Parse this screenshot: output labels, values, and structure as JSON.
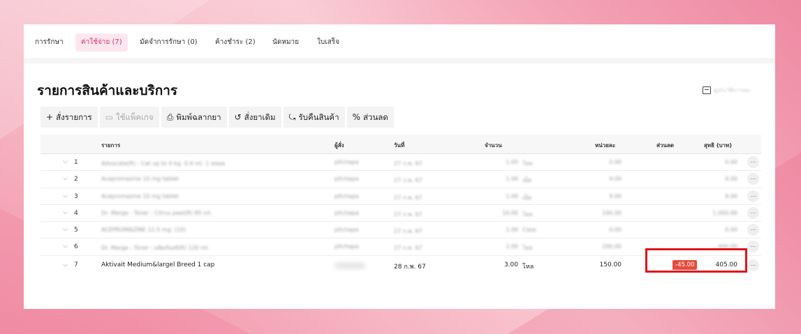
{
  "tabs": [
    {
      "label": "การรักษา",
      "active": false
    },
    {
      "label": "ค่าใช้จ่าย (7)",
      "active": true
    },
    {
      "label": "มัดจำการรักษา (0)",
      "active": false
    },
    {
      "label": "ค้างชำระ (2)",
      "active": false
    },
    {
      "label": "นัดหมาย",
      "active": false
    },
    {
      "label": "ใบเสร็จ",
      "active": false
    }
  ],
  "section": {
    "title": "รายการสินค้าและบริการ",
    "history_label": "ดูประวัติการลบ"
  },
  "toolbar": {
    "order": "สั่งรายการ",
    "package": "ใช้แพ็คเกจ",
    "print_label": "พิมพ์ฉลากยา",
    "reorder": "สั่งยาเดิม",
    "return": "รับคืนสินค้า",
    "discount": "ส่วนลด"
  },
  "table": {
    "headers": {
      "item": "รายการ",
      "orderer": "ผู้สั่ง",
      "date": "วันที่",
      "qty": "จำนวน",
      "unit_price": "หน่วยละ",
      "discount": "ส่วนลด",
      "net": "สุทธิ (บาท)"
    },
    "rows": [
      {
        "no": "1",
        "item": "Advocate(R) : Cat up to 4 kg. 0.4 ml. 1 หลอด",
        "orderer": "pitchapa",
        "date": "27 ก.พ. 67",
        "qty": "1.00",
        "unit": "โหล",
        "unit_price": "0.00",
        "discount": "",
        "net": "0.00"
      },
      {
        "no": "2",
        "item": "Acepromazine 10 mg tablet",
        "orderer": "pitchapa",
        "date": "27 ก.พ. 67",
        "qty": "1.00",
        "unit": "เม็ด",
        "unit_price": "9.00",
        "discount": "",
        "net": "9.00"
      },
      {
        "no": "3",
        "item": "Acepromazine 10 mg tablet",
        "orderer": "pitchapa",
        "date": "27 ก.พ. 67",
        "qty": "1.00",
        "unit": "เม็ด",
        "unit_price": "9.00",
        "discount": "",
        "net": "9.00"
      },
      {
        "no": "4",
        "item": "Dr. Merge : Toner : Citrus peel(R) 85 ml.",
        "orderer": "pitchapa",
        "date": "27 ก.พ. 67",
        "qty": "10.00",
        "unit": "โหล",
        "unit_price": "100.00",
        "discount": "",
        "net": "1,000.00"
      },
      {
        "no": "5",
        "item": "ACEPROMAZINE 12.5 mg. (10)",
        "orderer": "pitchapa",
        "date": "27 ก.พ. 67",
        "qty": "1.00",
        "unit": "Case",
        "unit_price": "0.00",
        "discount": "",
        "net": "0.00"
      },
      {
        "no": "6",
        "item": "Dr. Merge : Toner : ผลิตภัณฑ์(R) 120 ml.",
        "orderer": "pitchapa",
        "date": "27 ก.พ. 67",
        "qty": "2.00",
        "unit": "โหล",
        "unit_price": "200.00",
        "discount": "",
        "net": "400.00"
      },
      {
        "no": "7",
        "item": "Aktivait Medium&largel Breed 1 cap",
        "orderer": "",
        "date": "28 ก.พ. 67",
        "qty": "3.00",
        "unit": "โหล",
        "unit_price": "150.00",
        "discount": "-45.00",
        "net": "405.00"
      }
    ]
  },
  "colors": {
    "accent": "#d6336c",
    "active_tab_bg": "#fde7ee",
    "discount_badge": "#e74c3c",
    "highlight_box": "#e3131b"
  },
  "icons": {
    "order": "plus-icon",
    "package": "calendar-icon",
    "print_label": "printer-icon",
    "reorder": "history-icon",
    "return": "return-icon",
    "discount": "percent-icon",
    "history": "archive-icon",
    "row_expand": "chevron-down-icon",
    "row_more": "ellipsis-icon"
  }
}
